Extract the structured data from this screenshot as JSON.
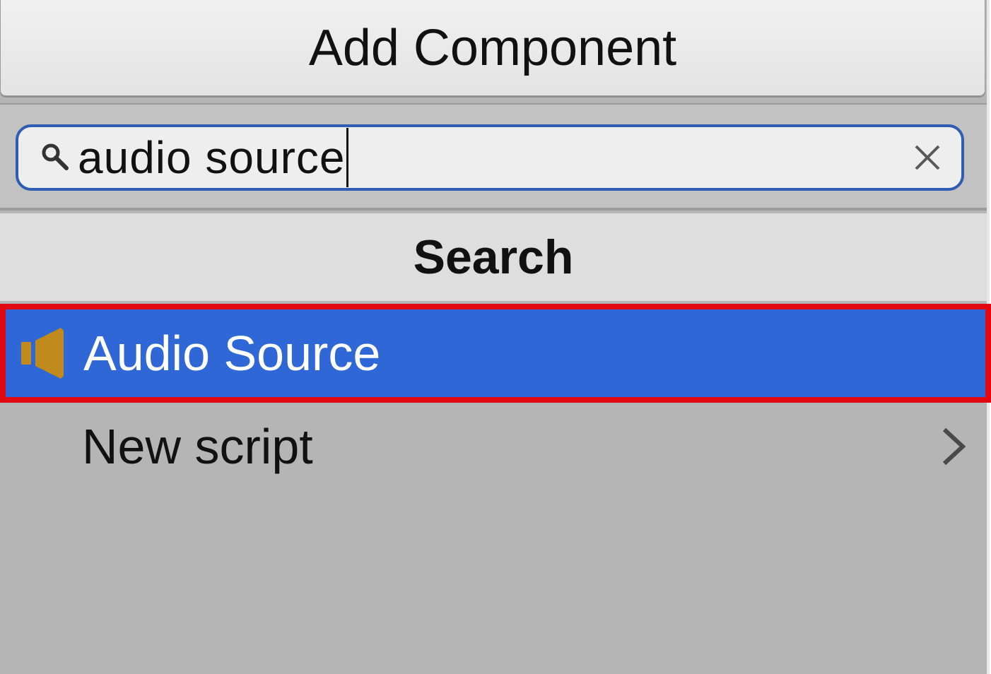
{
  "header": {
    "title": "Add Component"
  },
  "search": {
    "value": "audio source"
  },
  "section": {
    "title": "Search"
  },
  "results": [
    {
      "label": "Audio Source",
      "icon": "speaker-icon",
      "selected": true
    },
    {
      "label": "New script",
      "icon": "chevron-right-icon",
      "selected": false
    }
  ],
  "colors": {
    "selection": "#3067d6",
    "highlight_border": "#e10812",
    "search_border": "#2e5db3",
    "speaker_icon": "#c08a1c",
    "panel_bg": "#b5b5b5"
  }
}
